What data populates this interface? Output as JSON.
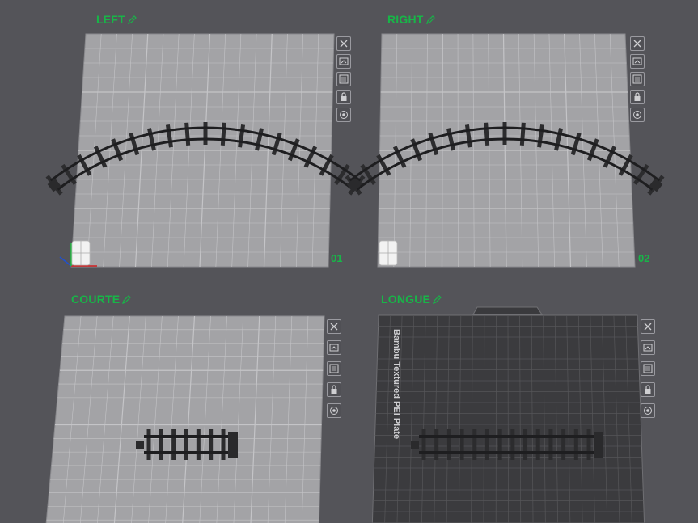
{
  "plates": [
    {
      "name": "LEFT",
      "number": "01"
    },
    {
      "name": "RIGHT",
      "number": "02"
    },
    {
      "name": "COURTE",
      "number": ""
    },
    {
      "name": "LONGUE",
      "number": "",
      "bed_label": "Bambu Textured PEI Plate"
    }
  ],
  "toolbar_icons": [
    "close-icon",
    "auto-arrange-icon",
    "plate-settings-icon",
    "lock-icon",
    "auto-orient-icon"
  ],
  "colors": {
    "label_green": "#18b548",
    "plate_light": "#a3a3a6",
    "plate_dark": "#3b3b3e",
    "background": "#545459"
  }
}
